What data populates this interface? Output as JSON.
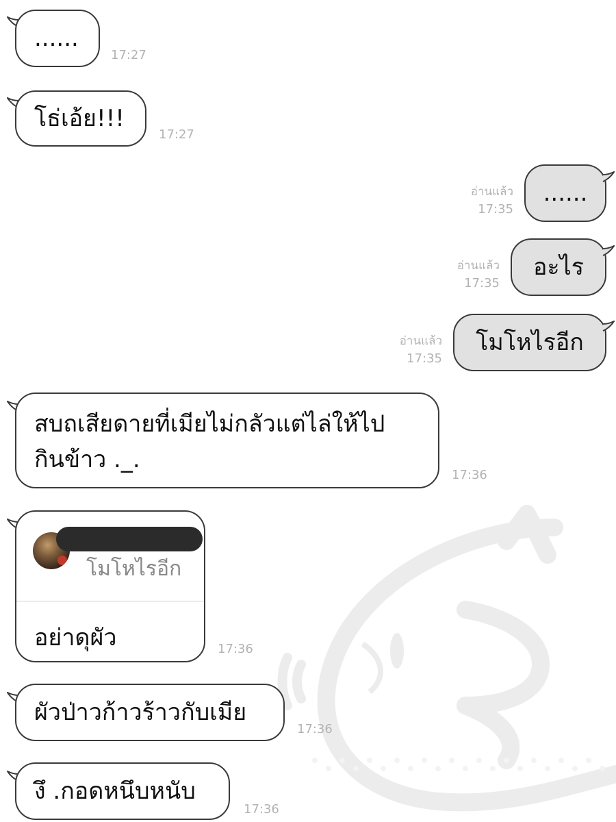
{
  "messages": [
    {
      "text": "......",
      "time": "17:27"
    },
    {
      "text": "โธ่เอ้ย!!!",
      "time": "17:27"
    },
    {
      "text": "......",
      "read": "อ่านแล้ว",
      "time": "17:35"
    },
    {
      "text": "อะไร",
      "read": "อ่านแล้ว",
      "time": "17:35"
    },
    {
      "text": "โมโหไรอีก",
      "read": "อ่านแล้ว",
      "time": "17:35"
    },
    {
      "line1": "สบถเสียดายที่เมียไม่กลัวแต่ไล่ให้ไป",
      "line2": "กินข้าว ._.",
      "time": "17:36"
    },
    {
      "quoted": "โมโหไรอีก",
      "text": "อย่าดุผัว",
      "time": "17:36"
    },
    {
      "text": "ผัวป่าวก้าวร้าวกับเมีย",
      "time": "17:36"
    },
    {
      "text": "งึ .กอดหนึบหนับ",
      "time": "17:36"
    }
  ],
  "colors": {
    "incoming_bubble": "#ffffff",
    "outgoing_bubble": "#e1e1e1",
    "border": "#3a3a3a",
    "meta_text": "#b3b3b3"
  }
}
